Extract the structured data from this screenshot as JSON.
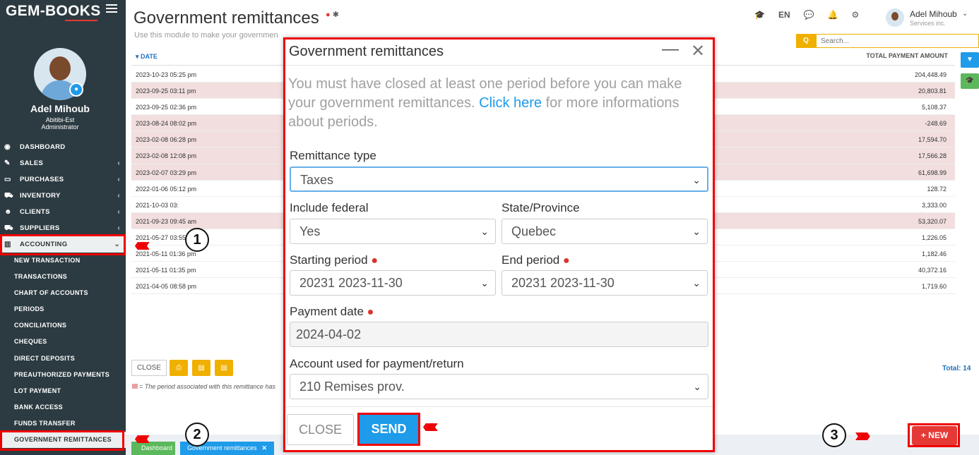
{
  "brand": {
    "name": "GEM-BOOKS"
  },
  "user": {
    "name": "Adel Mihoub",
    "org": "Abitibi-Est",
    "role": "Administrator",
    "top_org": "Services inc."
  },
  "sidebar": {
    "items": [
      {
        "label": "DASHBOARD",
        "icon": "dashboard-icon"
      },
      {
        "label": "SALES",
        "icon": "edit-icon"
      },
      {
        "label": "PURCHASES",
        "icon": "card-icon"
      },
      {
        "label": "INVENTORY",
        "icon": "cart-icon"
      },
      {
        "label": "CLIENTS",
        "icon": "users-icon"
      },
      {
        "label": "SUPPLIERS",
        "icon": "truck-icon"
      },
      {
        "label": "ACCOUNTING",
        "icon": "bar-chart-icon"
      }
    ],
    "accounting_sub": [
      "NEW TRANSACTION",
      "TRANSACTIONS",
      "CHART OF ACCOUNTS",
      "PERIODS",
      "CONCILIATIONS",
      "CHEQUES",
      "DIRECT DEPOSITS",
      "PREAUTHORIZED PAYMENTS",
      "LOT PAYMENT",
      "BANK ACCESS",
      "FUNDS TRANSFER",
      "GOVERNMENT REMITTANCES"
    ]
  },
  "header": {
    "title": "Government remittances",
    "subtitle": "Use this module to make your governmen",
    "lang": "EN",
    "search_placeholder": "Search..."
  },
  "table": {
    "col_date": "▾ DATE",
    "col_total": "TOTAL PAYMENT AMOUNT",
    "rows": [
      {
        "date": "2023-10-23 05:25 pm",
        "total": "204,448.49",
        "hl": false
      },
      {
        "date": "2023-09-25 03:11 pm",
        "total": "20,803.81",
        "hl": true
      },
      {
        "date": "2023-09-25 02:36 pm",
        "total": "5,108.37",
        "hl": false
      },
      {
        "date": "2023-08-24 08:02 pm",
        "total": "-248.69",
        "hl": true
      },
      {
        "date": "2023-02-08 06:28 pm",
        "total": "17,594.70",
        "hl": true
      },
      {
        "date": "2023-02-08 12:08 pm",
        "total": "17,566.28",
        "hl": true
      },
      {
        "date": "2023-02-07 03:29 pm",
        "total": "61,698.99",
        "hl": true
      },
      {
        "date": "2022-01-06 05:12 pm",
        "total": "128.72",
        "hl": false
      },
      {
        "date": "2021-10-03 03:",
        "total": "3,333.00",
        "hl": false
      },
      {
        "date": "2021-09-23 09:45 am",
        "total": "53,320.07",
        "hl": true
      },
      {
        "date": "2021-05-27 03:55 pm",
        "total": "1,226.05",
        "hl": false
      },
      {
        "date": "2021-05-11 01:36 pm",
        "total": "1,182.46",
        "hl": false
      },
      {
        "date": "2021-05-11 01:35 pm",
        "total": "40,372.16",
        "hl": false
      },
      {
        "date": "2021-04-05 08:58 pm",
        "total": "1,719.60",
        "hl": false
      }
    ],
    "close_label": "CLOSE",
    "legend": "= The period associated with this remittance has",
    "total_label": "Total: 14"
  },
  "footer": {
    "tab_dashboard": "Dashboard",
    "tab_gov": "Government remittances",
    "new_label": "+ NEW"
  },
  "annotations": {
    "n1": "1",
    "n2": "2",
    "n3": "3",
    "arrows_left": "«««",
    "arrows_right": "»»»"
  },
  "modal": {
    "title": "Government remittances",
    "msg_before": "You must have closed at least one period before you can make your government remittances. ",
    "msg_link": "Click here",
    "msg_after": " for more informations about periods.",
    "remittance_type_label": "Remittance type",
    "remittance_type_value": "Taxes",
    "include_federal_label": "Include federal",
    "include_federal_value": "Yes",
    "state_label": "State/Province",
    "state_value": "Quebec",
    "start_period_label": "Starting period",
    "start_period_value": "20231 2023-11-30",
    "end_period_label": "End period",
    "end_period_value": "20231 2023-11-30",
    "payment_date_label": "Payment date",
    "payment_date_value": "2024-04-02",
    "account_label": "Account used for payment/return",
    "account_value": "210 Remises prov.",
    "close_label": "CLOSE",
    "send_label": "SEND"
  },
  "colors": {
    "accent": "#1e9be9",
    "danger": "#e53935",
    "sidebar": "#2c3b41",
    "highlight_row": "#f2dede",
    "warning": "#f0b000"
  }
}
